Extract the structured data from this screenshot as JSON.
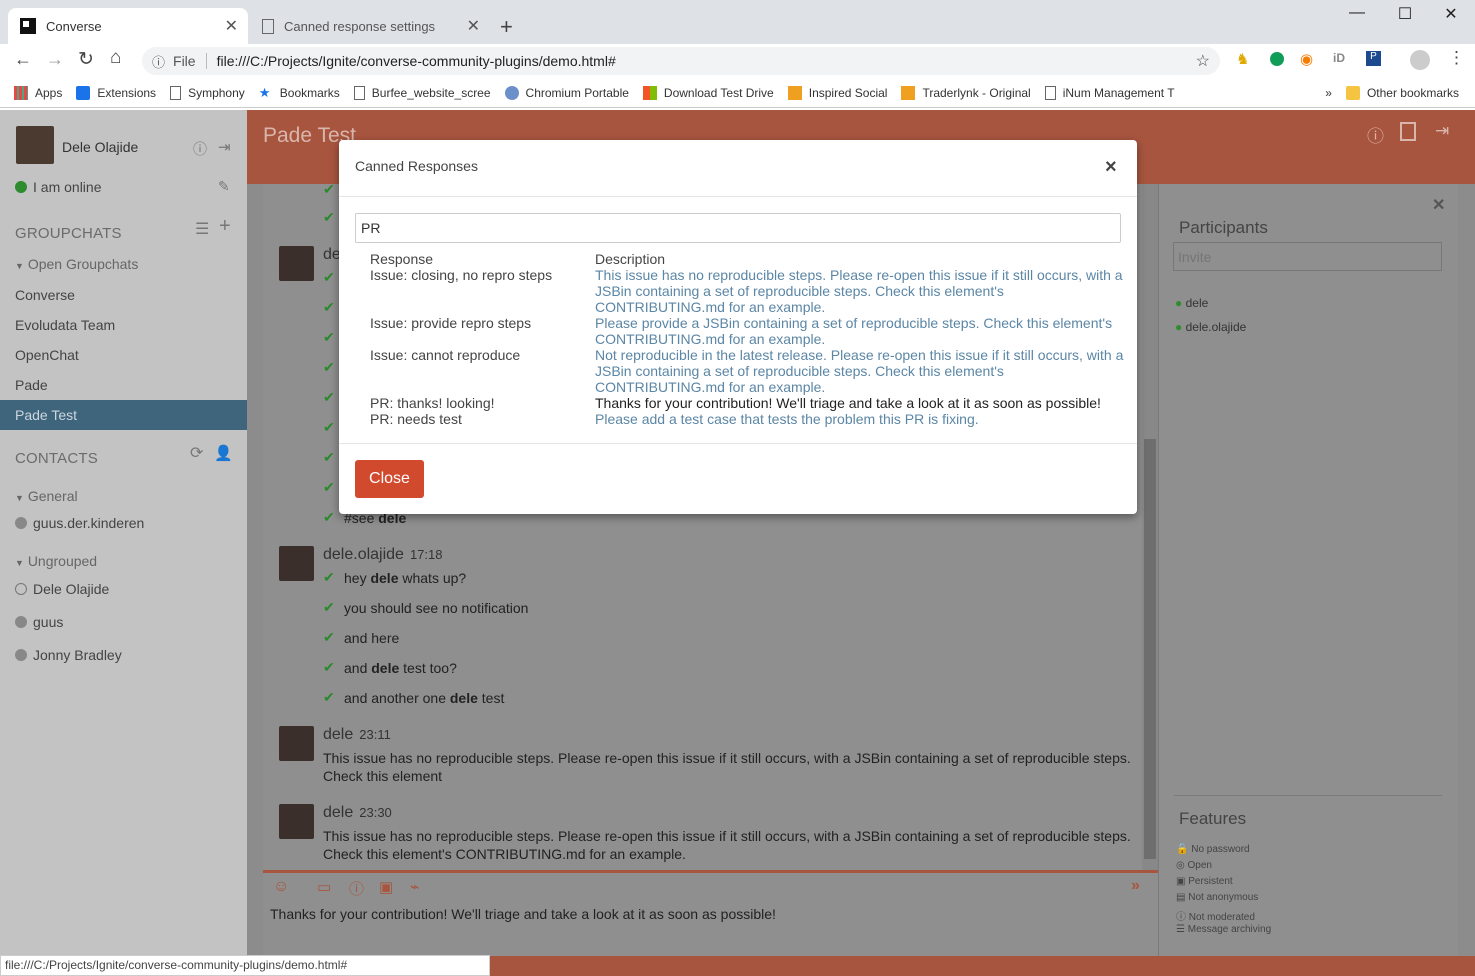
{
  "browser": {
    "tabs": [
      {
        "label": "Converse",
        "active": true
      },
      {
        "label": "Canned response settings",
        "active": false
      }
    ],
    "address_prefix": "File",
    "url": "file:///C:/Projects/Ignite/converse-community-plugins/demo.html#",
    "bookmarks": [
      "Apps",
      "Extensions",
      "Symphony",
      "Bookmarks",
      "Burfee_website_scree",
      "Chromium Portable",
      "Download Test Drive",
      "Inspired Social",
      "Traderlynk - Original",
      "iNum Management T"
    ],
    "other_bookmarks": "Other bookmarks",
    "status_url": "file:///C:/Projects/Ignite/converse-community-plugins/demo.html#"
  },
  "sidebar": {
    "user_name": "Dele Olajide",
    "status": "I am online",
    "groupchats_heading": "GROUPCHATS",
    "open_groupchats": "Open Groupchats",
    "rooms": [
      "Converse",
      "Evoludata Team",
      "OpenChat",
      "Pade",
      "Pade Test"
    ],
    "contacts_heading": "CONTACTS",
    "group_general": "General",
    "general_contacts": [
      "guus.der.kinderen"
    ],
    "group_ungrouped": "Ungrouped",
    "ungrouped_contacts": [
      "Dele Olajide",
      "guus",
      "Jonny Bradley"
    ]
  },
  "room": {
    "title": "Pade Test",
    "msg_header_1_name": "de",
    "msg_see": "#see ",
    "msg_see_bold": "dele",
    "block2": {
      "name": "dele.olajide",
      "time": "17:18",
      "lines": [
        {
          "pre": "hey ",
          "bold": "dele",
          "post": " whats up?"
        },
        {
          "pre": "you should see no notification",
          "bold": "",
          "post": ""
        },
        {
          "pre": "and here",
          "bold": "",
          "post": ""
        },
        {
          "pre": "and ",
          "bold": "dele",
          "post": " test too?"
        },
        {
          "pre": "and another one ",
          "bold": "dele",
          "post": " test"
        }
      ]
    },
    "block3": {
      "name": "dele",
      "time": "23:11",
      "text": "This issue has no reproducible steps. Please re-open this issue if it still occurs, with a JSBin containing a set of reproducible steps. Check this element"
    },
    "block4": {
      "name": "dele",
      "time": "23:30",
      "text": "This issue has no reproducible steps. Please re-open this issue if it still occurs, with a JSBin containing a set of reproducible steps. Check this element's CONTRIBUTING.md for an example."
    },
    "composer_text": "Thanks for your contribution! We'll triage and take a look at it as soon as possible!"
  },
  "participants": {
    "heading": "Participants",
    "invite_placeholder": "Invite",
    "list": [
      "dele",
      "dele.olajide"
    ]
  },
  "features": {
    "heading": "Features",
    "list": [
      "No password",
      "Open",
      "Persistent",
      "Not anonymous",
      "Not moderated",
      "Message archiving"
    ]
  },
  "modal": {
    "title": "Canned Responses",
    "search_value": "PR",
    "col_response": "Response",
    "col_description": "Description",
    "rows": [
      {
        "response": "Issue: closing, no repro steps",
        "description": "This issue has no reproducible steps. Please re-open this issue if it still occurs, with a JSBin containing a set of reproducible steps. Check this element's CONTRIBUTING.md for an example."
      },
      {
        "response": "Issue: provide repro steps",
        "description": "Please provide a JSBin containing a set of reproducible steps. Check this element's CONTRIBUTING.md for an example."
      },
      {
        "response": "Issue: cannot reproduce",
        "description": "Not reproducible in the latest release. Please re-open this issue if it still occurs, with a JSBin containing a set of reproducible steps. Check this element's CONTRIBUTING.md for an example."
      },
      {
        "response": "PR: thanks! looking!",
        "description": "Thanks for your contribution! We'll triage and take a look at it as soon as possible!"
      },
      {
        "response": "PR: needs test",
        "description": "Please add a test case that tests the problem this PR is fixing."
      }
    ],
    "close_label": "Close"
  },
  "colors": {
    "accent": "#a8553f",
    "sidebar_active": "#3f657d",
    "online": "#2e8b2e",
    "link_blue": "#5b86a5",
    "close_button": "#d14a2e"
  }
}
